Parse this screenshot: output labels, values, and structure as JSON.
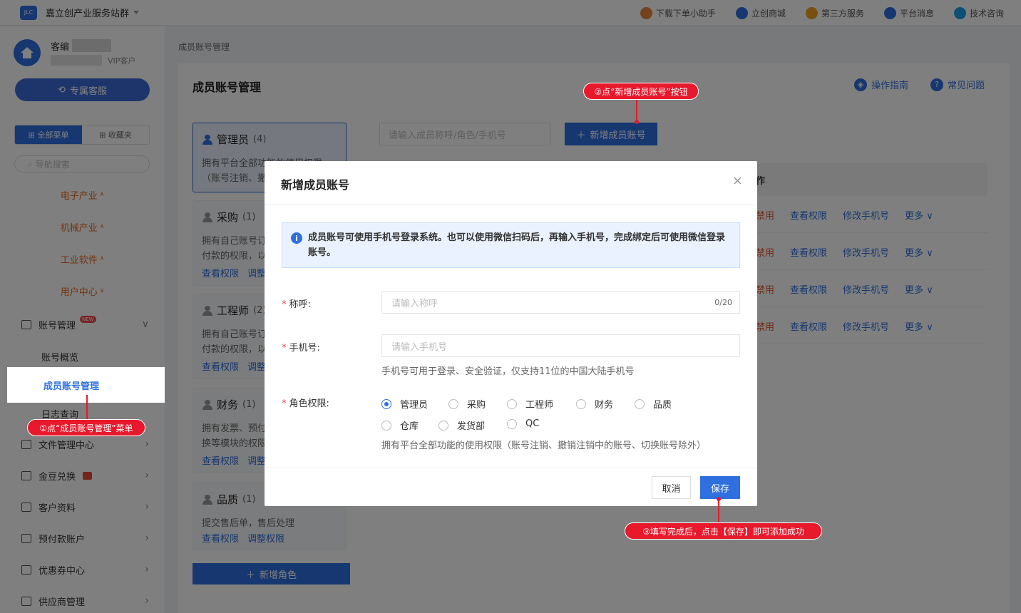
{
  "topbar": {
    "title": "嘉立创产业服务站群",
    "links": [
      {
        "label": "下载下单小助手",
        "icon": "robot-icon",
        "color": "#e8843a"
      },
      {
        "label": "立创商城",
        "icon": "store-icon",
        "color": "#2f6fe0"
      },
      {
        "label": "第三方服务",
        "icon": "grid-icon",
        "color": "#f0a020"
      },
      {
        "label": "平台消息",
        "icon": "bell-icon",
        "color": "#2f6fe0"
      },
      {
        "label": "技术咨询",
        "icon": "chat-icon",
        "color": "#1aa0e8"
      }
    ]
  },
  "sidebar": {
    "user_name": "客编",
    "vip": "VIP客户",
    "service_button": "专属客服",
    "tab_all": "全部菜单",
    "tab_fav": "收藏夹",
    "search_placeholder": "导航搜索",
    "categories": [
      "电子产业",
      "机械产业",
      "工业软件",
      "用户中心"
    ],
    "account_mgmt": "账号管理",
    "new_badge": "NEW",
    "sub_items": [
      "账号概览",
      "成员账号管理",
      "日志查询"
    ],
    "items": [
      "文件管理中心",
      "金豆兑换",
      "客户资料",
      "预付款账户",
      "优惠券中心",
      "供应商管理"
    ]
  },
  "main": {
    "breadcrumb": "成员账号管理",
    "title": "成员账号管理",
    "guide": "操作指南",
    "faq": "常见问题",
    "search_placeholder": "请输入成员称呼/角色/手机号",
    "add_member_button": "新增成员账号",
    "table_ops_header": "作",
    "row_ops": [
      "禁用",
      "查看权限",
      "修改手机号",
      "更多"
    ],
    "roles": [
      {
        "name": "管理员",
        "count": "(4)",
        "desc": "拥有平台全部功能的使用权限（账号注销、撤销注销中的账号、切换账号除外）"
      },
      {
        "name": "采购",
        "count": "(1)",
        "desc": "拥有自己账号订单下单、支付、付款的权限，以及所有订单的查看权限",
        "links": [
          "查看权限",
          "调整权限"
        ]
      },
      {
        "name": "工程师",
        "count": "(2)",
        "desc": "拥有自己账号订单下单、支付、付款的权限，以及所有订单的查看权限",
        "links": [
          "查看权限",
          "调整权限"
        ]
      },
      {
        "name": "财务",
        "count": "(1)",
        "desc": "拥有发票、预付款账户、金豆兑换等模块的权限及全部订单的查看权限",
        "links": [
          "查看权限",
          "调整权限"
        ]
      },
      {
        "name": "品质",
        "count": "(1)",
        "desc": "提交售后单，售后处理",
        "links": [
          "查看权限",
          "调整权限"
        ]
      }
    ],
    "add_role_button": "新增角色"
  },
  "modal": {
    "title": "新增成员账号",
    "info": "成员账号可使用手机号登录系统。也可以使用微信扫码后，再输入手机号，完成绑定后可使用微信登录账号。",
    "nickname_label": "称呼:",
    "nickname_placeholder": "请输入称呼",
    "nickname_count": "0/20",
    "phone_label": "手机号:",
    "phone_placeholder": "请输入手机号",
    "phone_hint": "手机号可用于登录、安全验证，仅支持11位的中国大陆手机号",
    "role_label": "角色权限:",
    "role_options": [
      "管理员",
      "采购",
      "工程师",
      "财务",
      "品质",
      "仓库",
      "发货部",
      "QC"
    ],
    "role_selected": "管理员",
    "role_desc": "拥有平台全部功能的使用权限（账号注销、撤销注销中的账号、切换账号除外）",
    "cancel": "取消",
    "save": "保存"
  },
  "callouts": {
    "step1": "①点“成员账号管理”菜单",
    "step2": "②点“新增成员账号”按钮",
    "step3": "③填写完成后，点击【保存】即可添加成功"
  }
}
